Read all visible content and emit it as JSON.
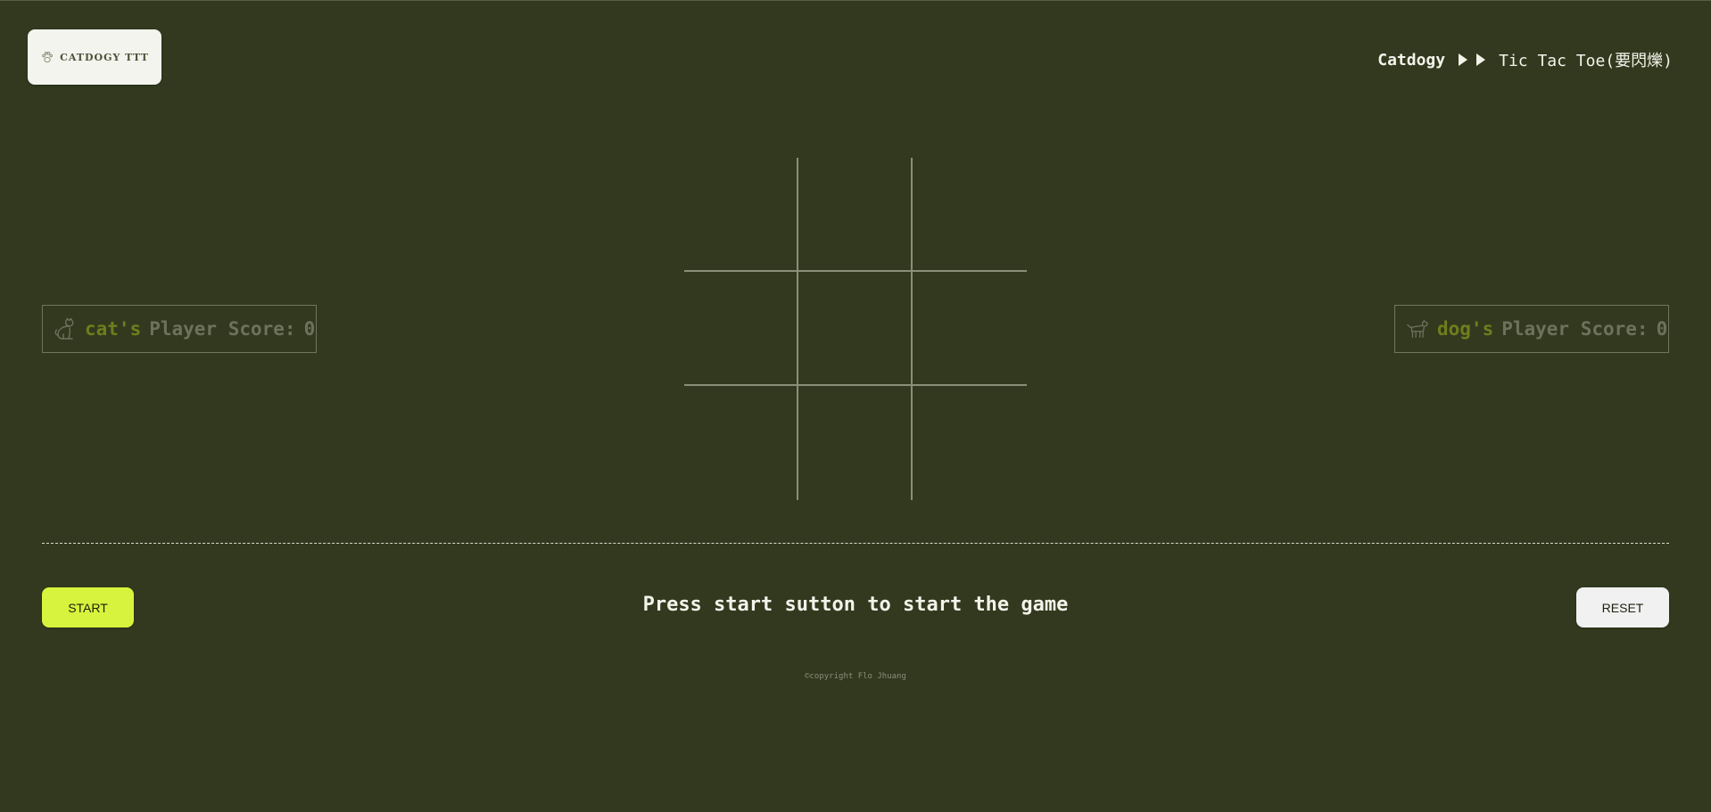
{
  "logo": {
    "icon": "paw-icon",
    "text": "CATDOGY TTT"
  },
  "breadcrumb": {
    "home": "Catdogy",
    "separator_icon": "play-arrows-icon",
    "current": "Tic Tac Toe(要閃爍)"
  },
  "board": {
    "cells": [
      "",
      "",
      "",
      "",
      "",
      "",
      "",
      "",
      ""
    ]
  },
  "players": {
    "cat": {
      "icon": "cat-icon",
      "name": "cat's",
      "label": "Player Score:",
      "score": "0"
    },
    "dog": {
      "icon": "dog-icon",
      "name": "dog's",
      "label": "Player Score:",
      "score": "0"
    }
  },
  "controls": {
    "start_label": "START",
    "reset_label": "RESET",
    "message": "Press start sutton to start the game"
  },
  "footer": {
    "copyright": "©copyright Flo Jhuang"
  },
  "colors": {
    "background": "#32391e",
    "start_button": "#d8f33d",
    "reset_button": "#f1f1f1",
    "player_name": "#6f7d1d",
    "grid_line": "#8a8f78"
  }
}
